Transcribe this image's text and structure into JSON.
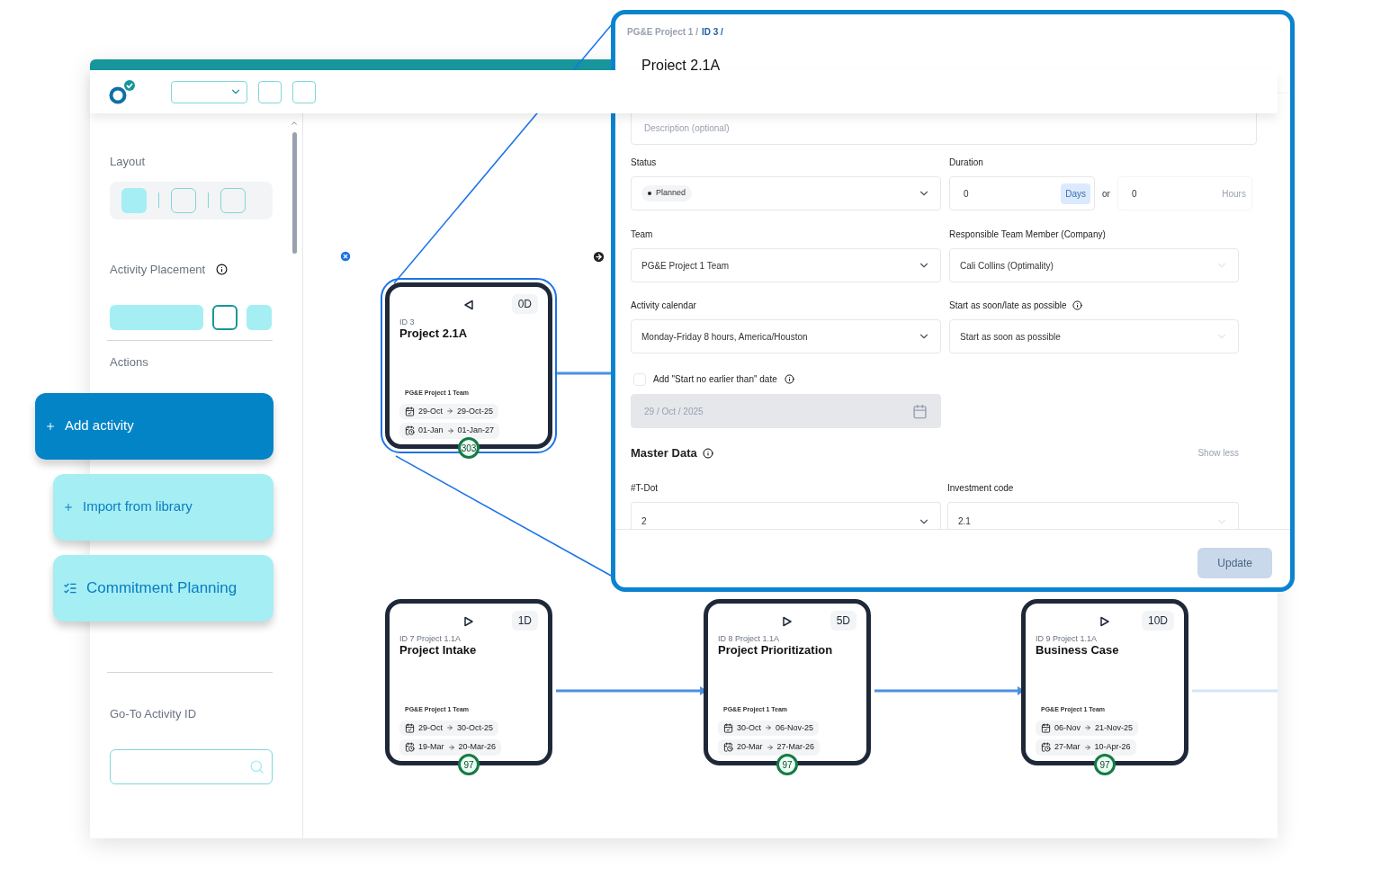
{
  "sidebar": {
    "layout": {
      "label": "Layout",
      "options": [
        {
          "selected": true
        },
        {
          "selected": false
        },
        {
          "selected": false
        }
      ]
    },
    "placement": {
      "label": "Activity Placement",
      "options": [
        {
          "selected": false
        },
        {
          "selected": true
        },
        {
          "selected": false
        }
      ]
    },
    "actions": {
      "label": "Actions",
      "buttons": [
        {
          "kind": "primary",
          "label": "Add activity"
        },
        {
          "kind": "secondary",
          "label": "Import from library"
        },
        {
          "kind": "planning",
          "label": "Commitment Planning"
        }
      ]
    },
    "goto": {
      "label": "Go-To Activity ID"
    }
  },
  "canvas": {
    "nodes": [
      {
        "id_line": "ID 3",
        "title": "Project 2.1A",
        "duration": "0D",
        "team": "PG&E Project 1 Team",
        "dates": [
          {
            "start": "29-Oct",
            "end": "29-Oct-25"
          },
          {
            "start": "01-Jan",
            "end": "01-Jan-27"
          }
        ],
        "score": "303",
        "selected": true,
        "kind": "back"
      },
      {
        "id_line": "ID 7 Project 1.1A",
        "title": "Project Intake",
        "duration": "1D",
        "team": "PG&E Project 1 Team",
        "dates": [
          {
            "start": "29-Oct",
            "end": "30-Oct-25"
          },
          {
            "start": "19-Mar",
            "end": "20-Mar-26"
          }
        ],
        "score": "97",
        "selected": false,
        "kind": "forward"
      },
      {
        "id_line": "ID 8 Project 1.1A",
        "title": "Project Prioritization",
        "duration": "5D",
        "team": "PG&E Project 1 Team",
        "dates": [
          {
            "start": "30-Oct",
            "end": "06-Nov-25"
          },
          {
            "start": "20-Mar",
            "end": "27-Mar-26"
          }
        ],
        "score": "97",
        "selected": false,
        "kind": "forward"
      },
      {
        "id_line": "ID 9 Project 1.1A",
        "title": "Business Case",
        "duration": "10D",
        "team": "PG&E Project 1 Team",
        "dates": [
          {
            "start": "06-Nov",
            "end": "21-Nov-25"
          },
          {
            "start": "27-Mar",
            "end": "10-Apr-26"
          }
        ],
        "score": "97",
        "selected": false,
        "kind": "forward"
      }
    ]
  },
  "panel": {
    "breadcrumb": [
      {
        "label": "PG&E Project 1 /",
        "selected": false
      },
      {
        "label": "ID 3 /",
        "selected": true
      }
    ],
    "title": "Project 2.1A",
    "description": {
      "placeholder": "Description (optional)"
    },
    "status": {
      "label": "Status",
      "value": "Planned"
    },
    "duration": {
      "label": "Duration",
      "days": "0",
      "days_unit": "Days",
      "or": "or",
      "hours": "0",
      "hours_unit": "Hours"
    },
    "team": {
      "label": "Team",
      "value": "PG&E Project 1 Team"
    },
    "responsible": {
      "label": "Responsible Team Member (Company)",
      "value": "Cali Collins (Optimality)"
    },
    "calendar": {
      "label": "Activity calendar",
      "value": "Monday-Friday 8 hours, America/Houston"
    },
    "start_mode": {
      "label": "Start as soon/late as possible",
      "value": "Start as soon as possible"
    },
    "start_no_earlier": {
      "label": "Add \"Start no earlier than\" date",
      "checked": false,
      "date": "29 / Oct / 2025",
      "disabled": true
    },
    "master_data": {
      "title": "Master Data",
      "toggle": "Show less",
      "fields": [
        {
          "label": "#T-Dot",
          "value": "2"
        },
        {
          "label": "Investment code",
          "value": "2.1"
        }
      ]
    },
    "submit": "Update"
  }
}
